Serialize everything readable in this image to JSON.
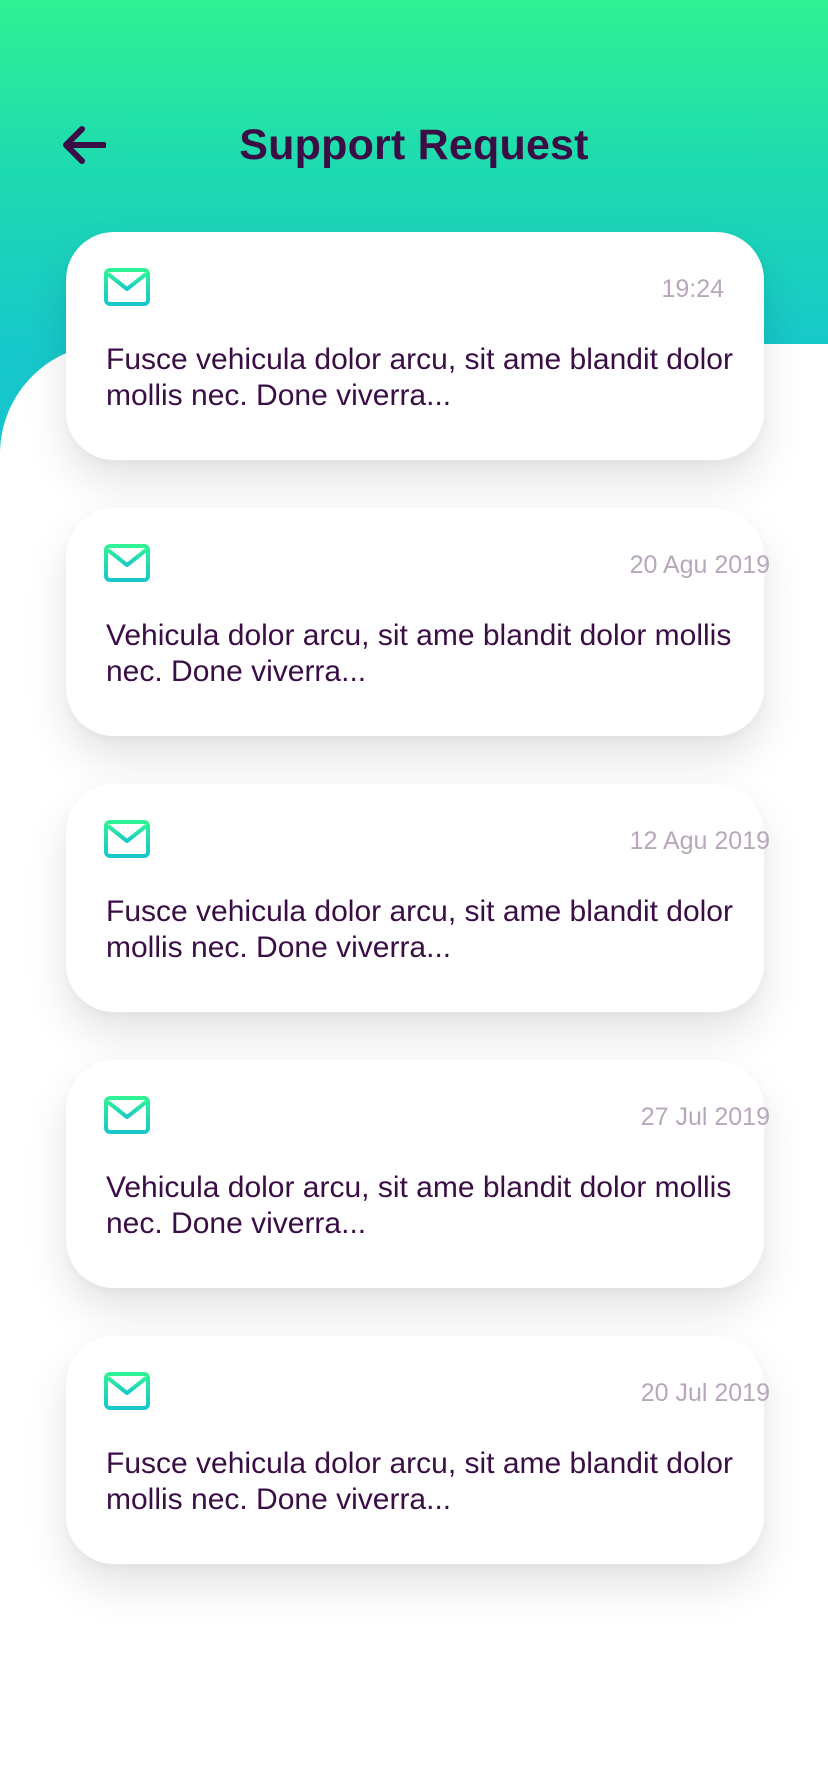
{
  "header": {
    "title": "Support Request",
    "back_icon": "arrow-left-icon"
  },
  "colors": {
    "gradient_top": "#2ef293",
    "gradient_bottom": "#17c8ca",
    "title": "#3a0d45",
    "date": "#b7a7bb",
    "message": "#3a0d45"
  },
  "requests": [
    {
      "icon": "mail-icon",
      "date": "19:24",
      "message": "Fusce vehicula dolor arcu, sit ame blandit dolor mollis nec. Done viverra..."
    },
    {
      "icon": "mail-icon",
      "date": "20 Agu 2019",
      "message": "Vehicula dolor arcu, sit ame blandit dolor mollis nec. Done viverra..."
    },
    {
      "icon": "mail-icon",
      "date": "12 Agu 2019",
      "message": "Fusce vehicula dolor arcu, sit ame blandit dolor mollis nec. Done viverra..."
    },
    {
      "icon": "mail-icon",
      "date": "27 Jul 2019",
      "message": "Vehicula dolor arcu, sit ame blandit dolor mollis nec. Done viverra..."
    },
    {
      "icon": "mail-icon",
      "date": "20 Jul 2019",
      "message": "Fusce vehicula dolor arcu, sit ame blandit dolor mollis nec. Done viverra..."
    }
  ]
}
